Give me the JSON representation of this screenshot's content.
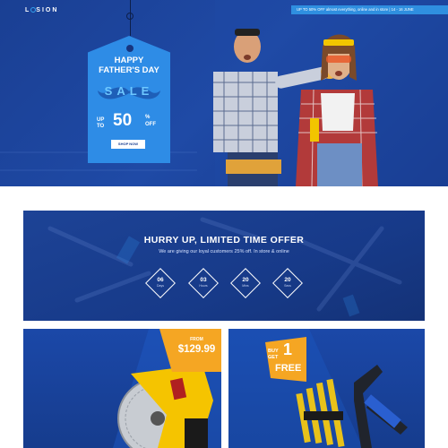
{
  "brand": {
    "logo_text_before": "L",
    "logo_text_after": "SION"
  },
  "promo_bar": {
    "text": "UP TO 50% OFF almost everything, online and in store  |  14 - 16 JUNE"
  },
  "hero": {
    "tag_title_line1": "HAPPY",
    "tag_title_line2": "FATHER'S DAY",
    "tag_sale": "SALE",
    "tag_upto_line1": "UP",
    "tag_upto_line2": "TO",
    "tag_percent": "50",
    "tag_percent_sign": "%",
    "tag_off": "OFF",
    "shop_button": "SHOP NOW"
  },
  "offer": {
    "title": "HURRY UP, LIMITED TIME OFFER",
    "subtitle": "We are giving our loyal customers 25% off. In store & online",
    "countdown": [
      {
        "value": "06",
        "label": "Days"
      },
      {
        "value": "03",
        "label": "Hours"
      },
      {
        "value": "20",
        "label": "Mins"
      },
      {
        "value": "20",
        "label": "Secs"
      }
    ]
  },
  "cards": {
    "card1": {
      "from_label": "FROM",
      "price": "$129.99"
    },
    "card2": {
      "buy_line": "BUY",
      "get_line": "GET",
      "number": "1",
      "free": "FREE"
    }
  },
  "colors": {
    "brand_blue": "#1a3f93",
    "accent_blue": "#2e8ce6",
    "accent_orange": "#f5a623",
    "tool_yellow": "#f5c400"
  }
}
